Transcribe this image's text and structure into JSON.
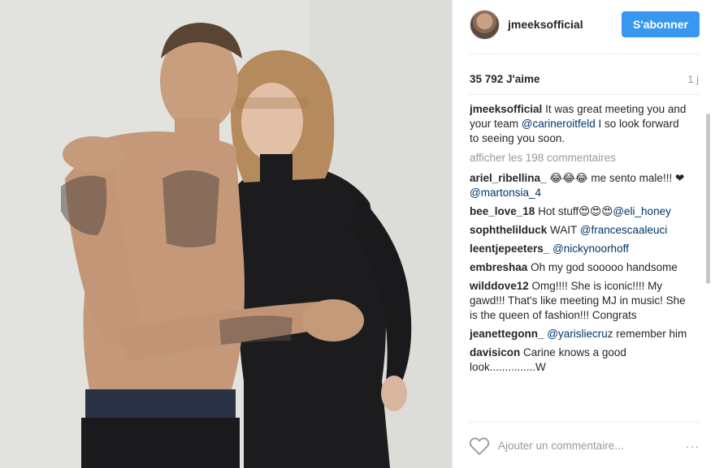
{
  "post": {
    "username": "jmeeksofficial",
    "follow_label": "S'abonner",
    "likes": "35 792 J'aime",
    "time_ago": "1 j",
    "show_all_comments": "afficher les 198 commentaires",
    "add_comment_placeholder": "Ajouter un commentaire...",
    "more_icon": "···"
  },
  "caption": {
    "user": "jmeeksofficial",
    "text_1": "It was great meeting you and your team ",
    "mention": "@carineroitfeld",
    "text_2": " I so look forward to seeing you soon."
  },
  "comments": [
    {
      "user": "ariel_ribellina_",
      "text": "😂😂😂 me sento male!!! ❤ ",
      "mention": "@martonsia_4",
      "text_after": ""
    },
    {
      "user": "bee_love_18",
      "text": "Hot stuff😍😍😍",
      "mention": "@eli_honey",
      "text_after": ""
    },
    {
      "user": "sophthelilduck",
      "text": "WAIT ",
      "mention": "@francescaaleuci",
      "text_after": ""
    },
    {
      "user": "leentjepeeters_",
      "text": "",
      "mention": "@nickynoorhoff",
      "text_after": ""
    },
    {
      "user": "embreshaa",
      "text": "Oh my god sooooo handsome",
      "mention": "",
      "text_after": ""
    },
    {
      "user": "wilddove12",
      "text": "Omg!!!! She is iconic!!!! My gawd!!! That's like meeting MJ in music! She is the queen of fashion!!! Congrats",
      "mention": "",
      "text_after": ""
    },
    {
      "user": "jeanettegonn_",
      "text": "",
      "mention": "@yarisliecruz",
      "text_after": " remember him"
    },
    {
      "user": "davisicon",
      "text": "Carine knows a good look...............W",
      "mention": "",
      "text_after": ""
    }
  ],
  "colors": {
    "accent": "#3897f0",
    "mention": "#003569",
    "muted": "#999999"
  },
  "icons": {
    "like": "heart-icon",
    "options": "more-options-icon"
  }
}
